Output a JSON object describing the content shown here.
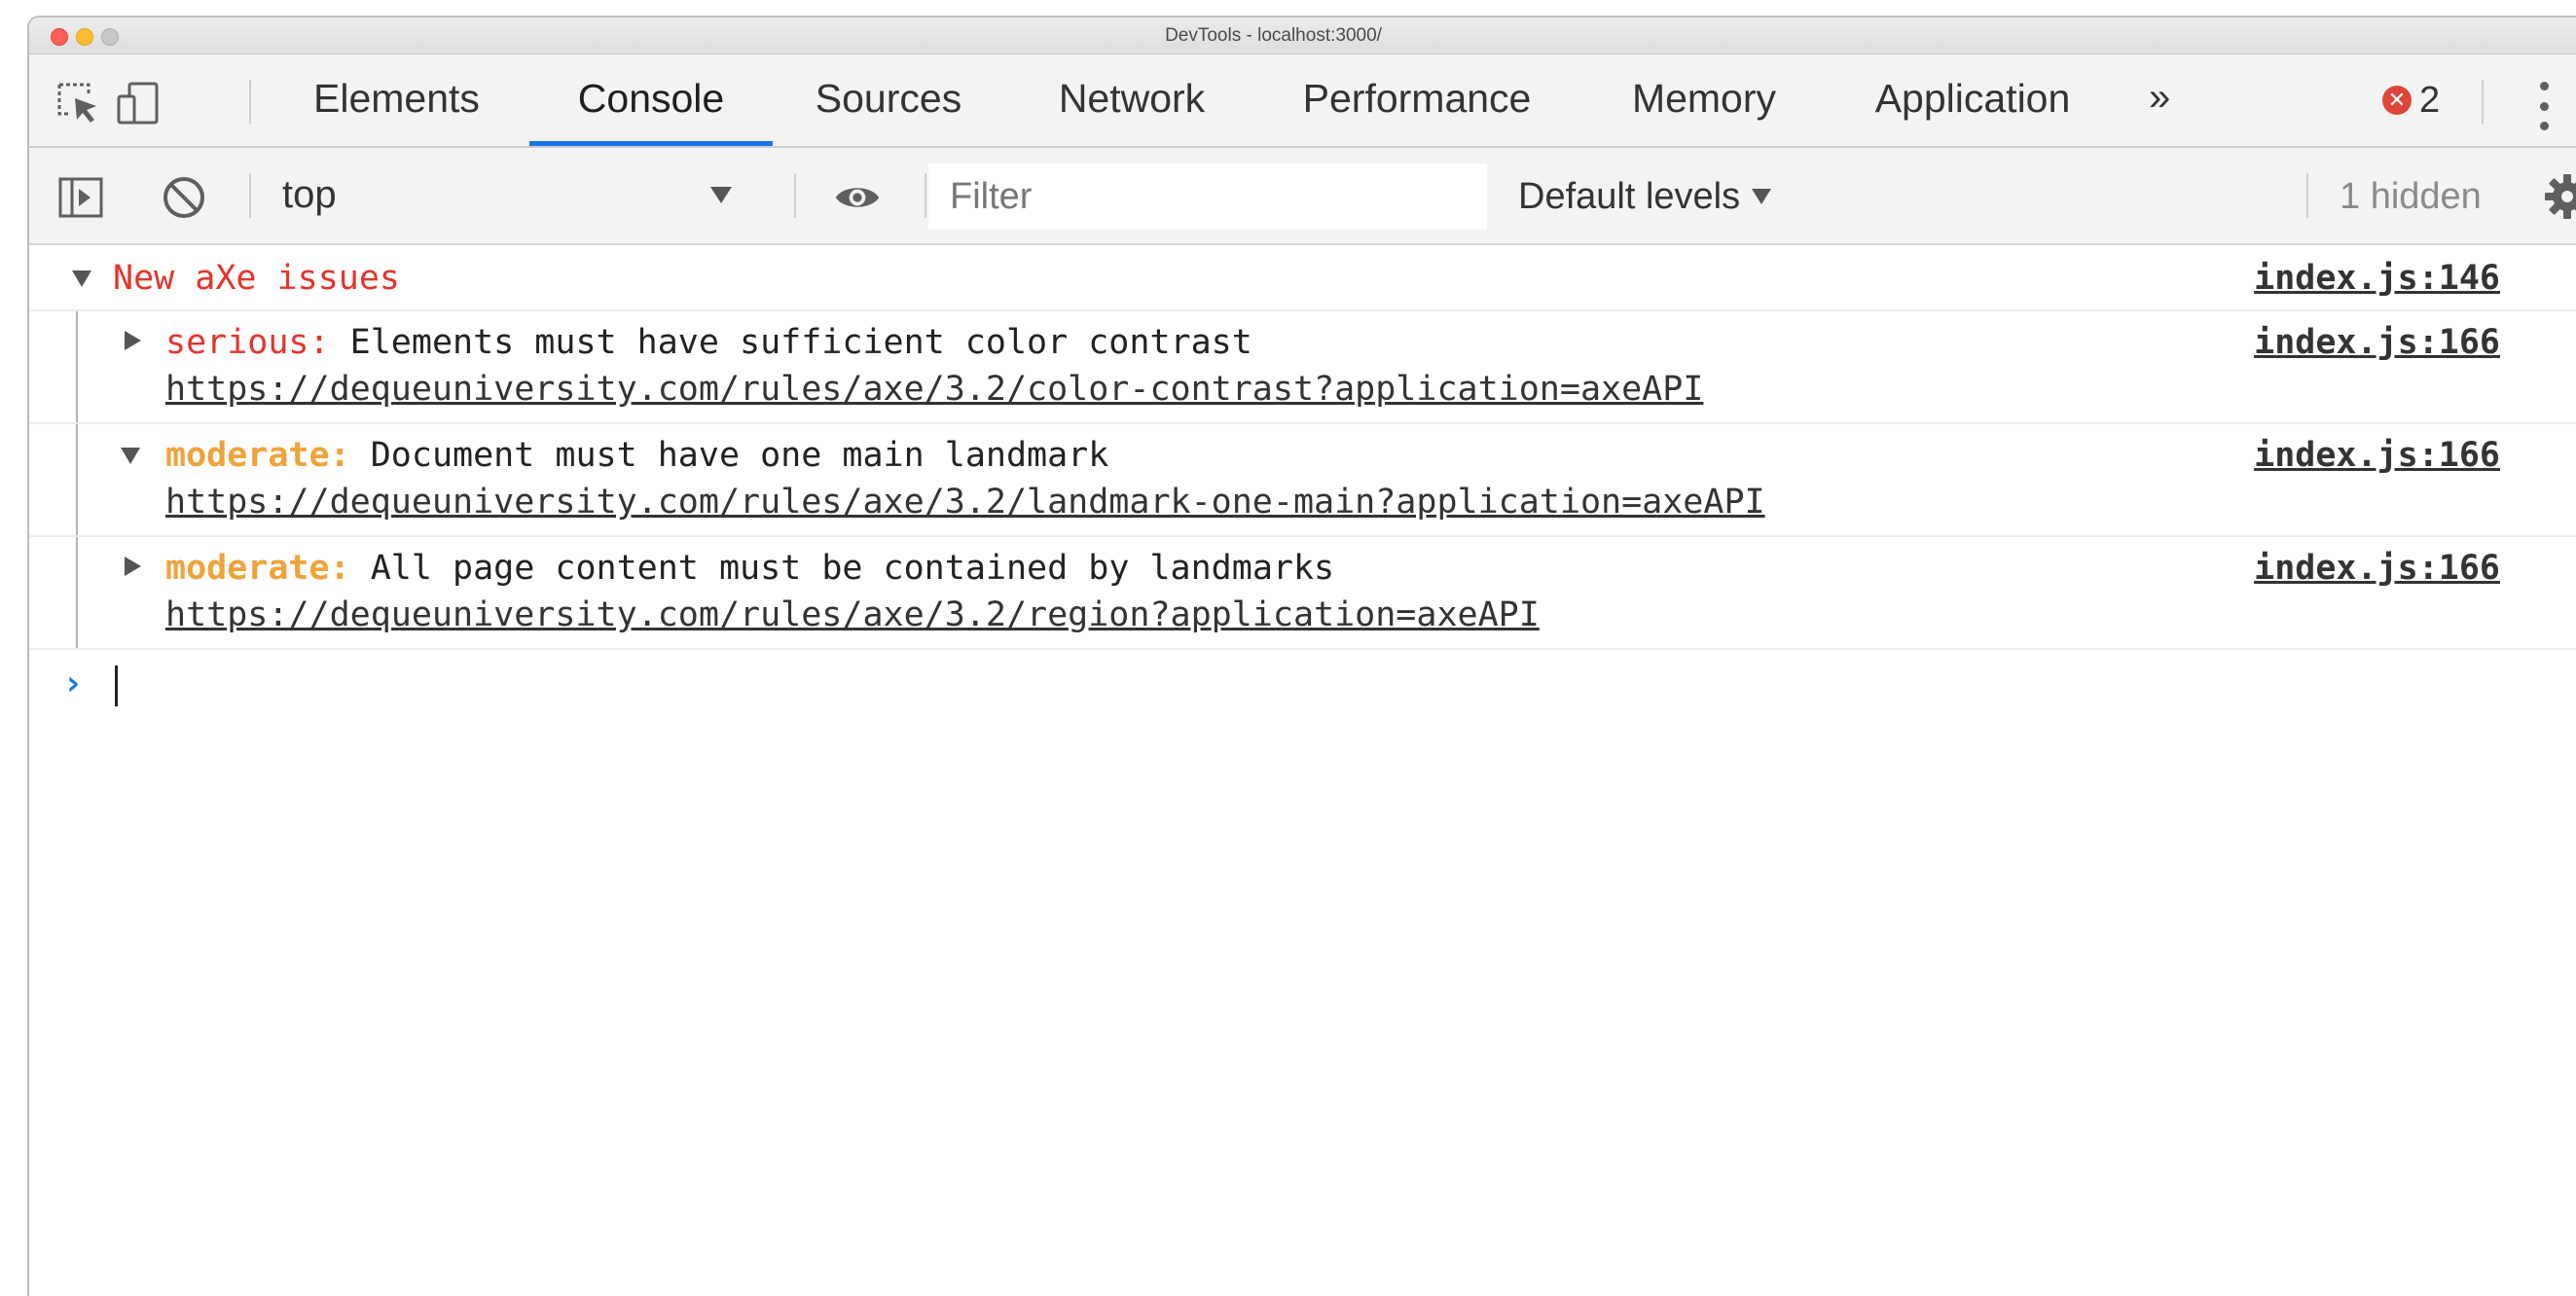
{
  "window": {
    "title": "DevTools - localhost:3000/"
  },
  "tabbar": {
    "tabs": [
      {
        "label": "Elements",
        "active": false
      },
      {
        "label": "Console",
        "active": true
      },
      {
        "label": "Sources",
        "active": false
      },
      {
        "label": "Network",
        "active": false
      },
      {
        "label": "Performance",
        "active": false
      },
      {
        "label": "Memory",
        "active": false
      },
      {
        "label": "Application",
        "active": false
      }
    ],
    "more_label": "»",
    "error_count": "2",
    "icons": [
      "inspect-element-icon",
      "device-toolbar-icon",
      "error-icon",
      "more-options-icon"
    ]
  },
  "console_toolbar": {
    "context": "top",
    "filter_placeholder": "Filter",
    "filter_value": "",
    "levels_label": "Default levels",
    "hidden_label": "1 hidden",
    "icons": [
      "sidebar-toggle-icon",
      "clear-console-icon",
      "eye-icon",
      "settings-gear-icon"
    ]
  },
  "messages": {
    "group": {
      "title": "New aXe issues",
      "source": "index.js:146"
    },
    "entries": [
      {
        "severity": "serious:",
        "severity_color": "#e8332a",
        "message": "Elements must have sufficient color contrast",
        "url": "https://dequeuniversity.com/rules/axe/3.2/color-contrast?application=axeAPI",
        "source": "index.js:166",
        "expanded": false
      },
      {
        "severity": "moderate:",
        "severity_color": "#f0a23a",
        "message": "Document must have one main landmark",
        "url": "https://dequeuniversity.com/rules/axe/3.2/landmark-one-main?application=axeAPI",
        "source": "index.js:166",
        "expanded": true
      },
      {
        "severity": "moderate:",
        "severity_color": "#f0a23a",
        "message": "All page content must be contained by landmarks",
        "url": "https://dequeuniversity.com/rules/axe/3.2/region?application=axeAPI",
        "source": "index.js:166",
        "expanded": false
      }
    ]
  },
  "prompt": {
    "symbol": "›"
  },
  "colors": {
    "accent": "#1a73e8",
    "error": "#e8332a",
    "warning": "#f0a23a"
  }
}
